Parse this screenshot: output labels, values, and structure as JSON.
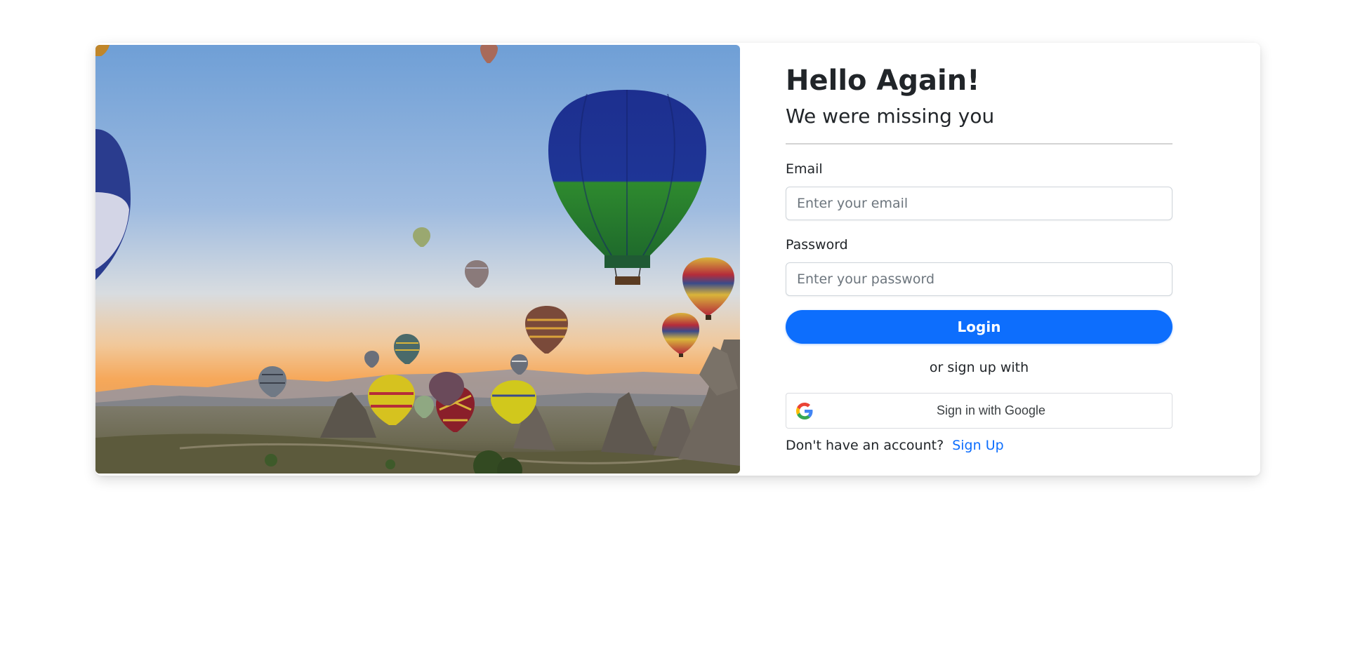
{
  "hero": {
    "image": "hot-air-balloons-landscape"
  },
  "form": {
    "title": "Hello Again!",
    "subtitle": "We were missing you",
    "email": {
      "label": "Email",
      "placeholder": "Enter your email",
      "value": ""
    },
    "password": {
      "label": "Password",
      "placeholder": "Enter your password",
      "value": ""
    },
    "login_label": "Login",
    "or_text": "or sign up with",
    "google": {
      "label": "Sign in with Google",
      "icon": "google-icon"
    },
    "signup": {
      "prompt": "Don't have an account?",
      "link": "Sign Up"
    }
  },
  "colors": {
    "primary": "#0d6efd",
    "text": "#212529",
    "placeholder": "#6c757d",
    "divider": "#d3d3d3"
  }
}
